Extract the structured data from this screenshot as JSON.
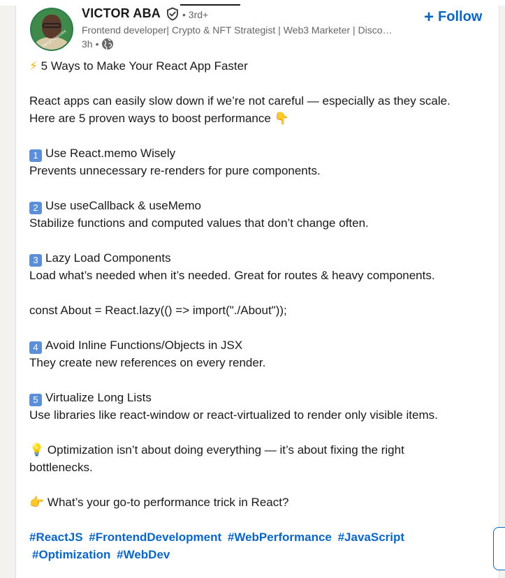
{
  "author": {
    "name": "VICTOR ABA",
    "degree": "• 3rd+",
    "headline": "Frontend developer| Crypto & NFT Strategist | Web3 Marketer | Disco…",
    "time": "3h",
    "meta_dot": "•",
    "avatar_ring_text": "#FORCETOWORK"
  },
  "follow": {
    "plus": "+",
    "label": "Follow"
  },
  "post": {
    "title_emoji": "⚡",
    "title": "5 Ways to Make Your React App Faster",
    "intro_1": "React apps can easily slow down if we’re not careful — especially as they scale.",
    "intro_2": "Here are 5 proven ways to boost performance",
    "intro_2_emoji": "👇",
    "tips": [
      {
        "num": "1",
        "title": "Use React.memo Wisely",
        "desc": "Prevents unnecessary re-renders for pure components."
      },
      {
        "num": "2",
        "title": "Use useCallback & useMemo",
        "desc": "Stabilize functions and computed values that don’t change often."
      },
      {
        "num": "3",
        "title": "Lazy Load Components",
        "desc": "Load what’s needed when it’s needed. Great for routes & heavy components."
      },
      {
        "num": "4",
        "title": "Avoid Inline Functions/Objects in JSX",
        "desc": "They create new references on every render."
      },
      {
        "num": "5",
        "title": "Virtualize Long Lists",
        "desc": "Use libraries like react-window or react-virtualized to render only visible items."
      }
    ],
    "code": "const About = React.lazy(() => import(\"./About\"));",
    "insight_emoji": "💡",
    "insight_1": "Optimization isn’t about doing everything — it’s about fixing the right",
    "insight_2": "bottlenecks.",
    "question_emoji": "👉",
    "question": "What’s your go-to performance trick in React?"
  },
  "hashtags": {
    "line1": [
      "#ReactJS",
      "#FrontendDevelopment",
      "#WebPerformance",
      "#JavaScript"
    ],
    "line2": [
      "#Optimization",
      "#WebDev"
    ]
  },
  "colors": {
    "link": "#0a66c2",
    "muted": "#666666",
    "text": "#1a1a1a",
    "keycap": "#5b8fd8"
  },
  "icons": {
    "verified": "shield-check-icon",
    "visibility": "globe-icon",
    "tip_number": "keycap-icon"
  }
}
